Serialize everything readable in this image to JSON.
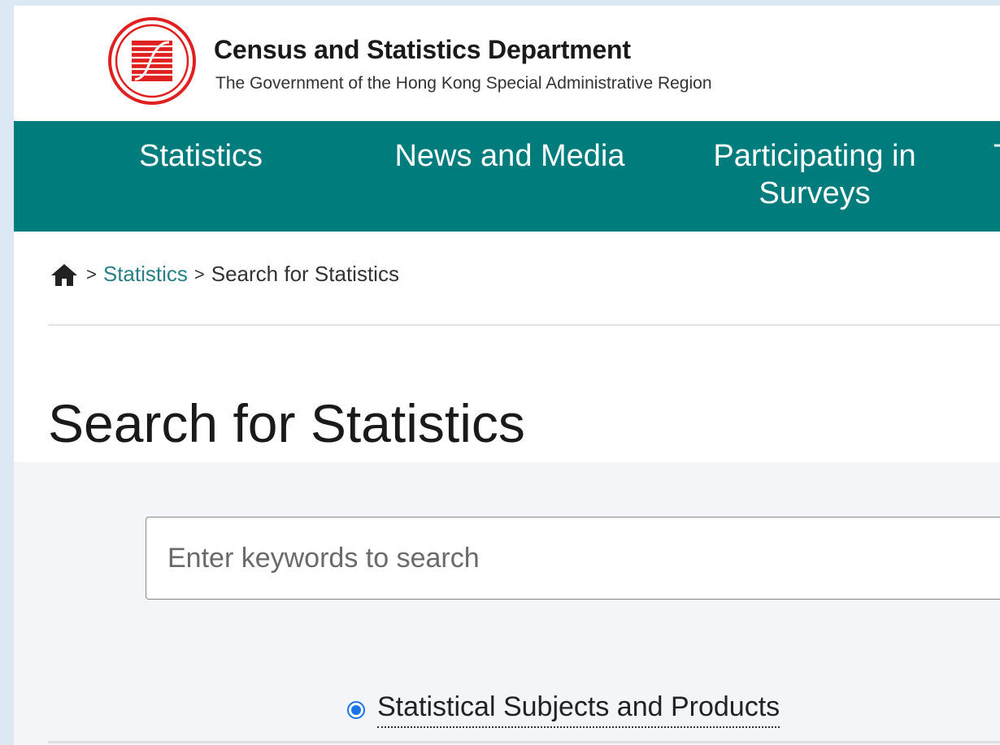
{
  "header": {
    "logo_icon": "csd-logo-icon",
    "department_name": "Census and Statistics Department",
    "government_name": "The Government of the Hong Kong Special Administrative Region"
  },
  "nav": {
    "items": [
      {
        "label": "Statistics"
      },
      {
        "label": "News and Media"
      },
      {
        "label": "Participating in Surveys"
      },
      {
        "label": "T"
      }
    ]
  },
  "breadcrumb": {
    "home_icon": "home-icon",
    "separator": ">",
    "items": [
      {
        "label": "Statistics"
      },
      {
        "label": "Search for Statistics"
      }
    ]
  },
  "page": {
    "title": "Search for Statistics"
  },
  "search": {
    "placeholder": "Enter keywords to search",
    "value": "",
    "options": [
      {
        "label": "Statistical Subjects and Products",
        "selected": true
      }
    ]
  },
  "colors": {
    "nav_background": "#007c7c",
    "link": "#2a7f86",
    "logo_red": "#e02020",
    "radio_accent": "#1a73e8"
  }
}
